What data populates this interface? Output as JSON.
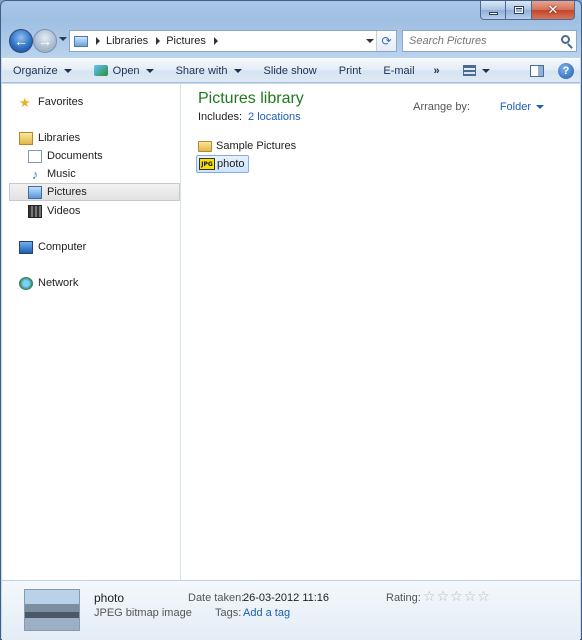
{
  "address_bar": {
    "crumbs": [
      "Libraries",
      "Pictures"
    ]
  },
  "search": {
    "placeholder": "Search Pictures"
  },
  "toolbar": {
    "organize": "Organize",
    "open": "Open",
    "share_with": "Share with",
    "slide_show": "Slide show",
    "print": "Print",
    "email": "E-mail",
    "more": "»"
  },
  "navigation": {
    "favorites": "Favorites",
    "libraries": "Libraries",
    "documents": "Documents",
    "music": "Music",
    "pictures": "Pictures",
    "videos": "Videos",
    "computer": "Computer",
    "network": "Network"
  },
  "library": {
    "title": "Pictures library",
    "includes_label": "Includes:",
    "locations_link": "2 locations",
    "arrange_label": "Arrange by:",
    "arrange_value": "Folder"
  },
  "files": [
    {
      "name": "Sample Pictures",
      "type": "folder"
    },
    {
      "name": "photo",
      "type": "jpg",
      "badge": "JPG"
    }
  ],
  "details": {
    "name": "photo",
    "type": "JPEG bitmap image",
    "date_label": "Date taken:",
    "date_value": "26-03-2012 11:16",
    "tags_label": "Tags:",
    "tags_value": "Add a tag",
    "rating_label": "Rating:",
    "rating_stars": [
      "☆",
      "☆",
      "☆",
      "☆",
      "☆"
    ]
  },
  "help": "?"
}
